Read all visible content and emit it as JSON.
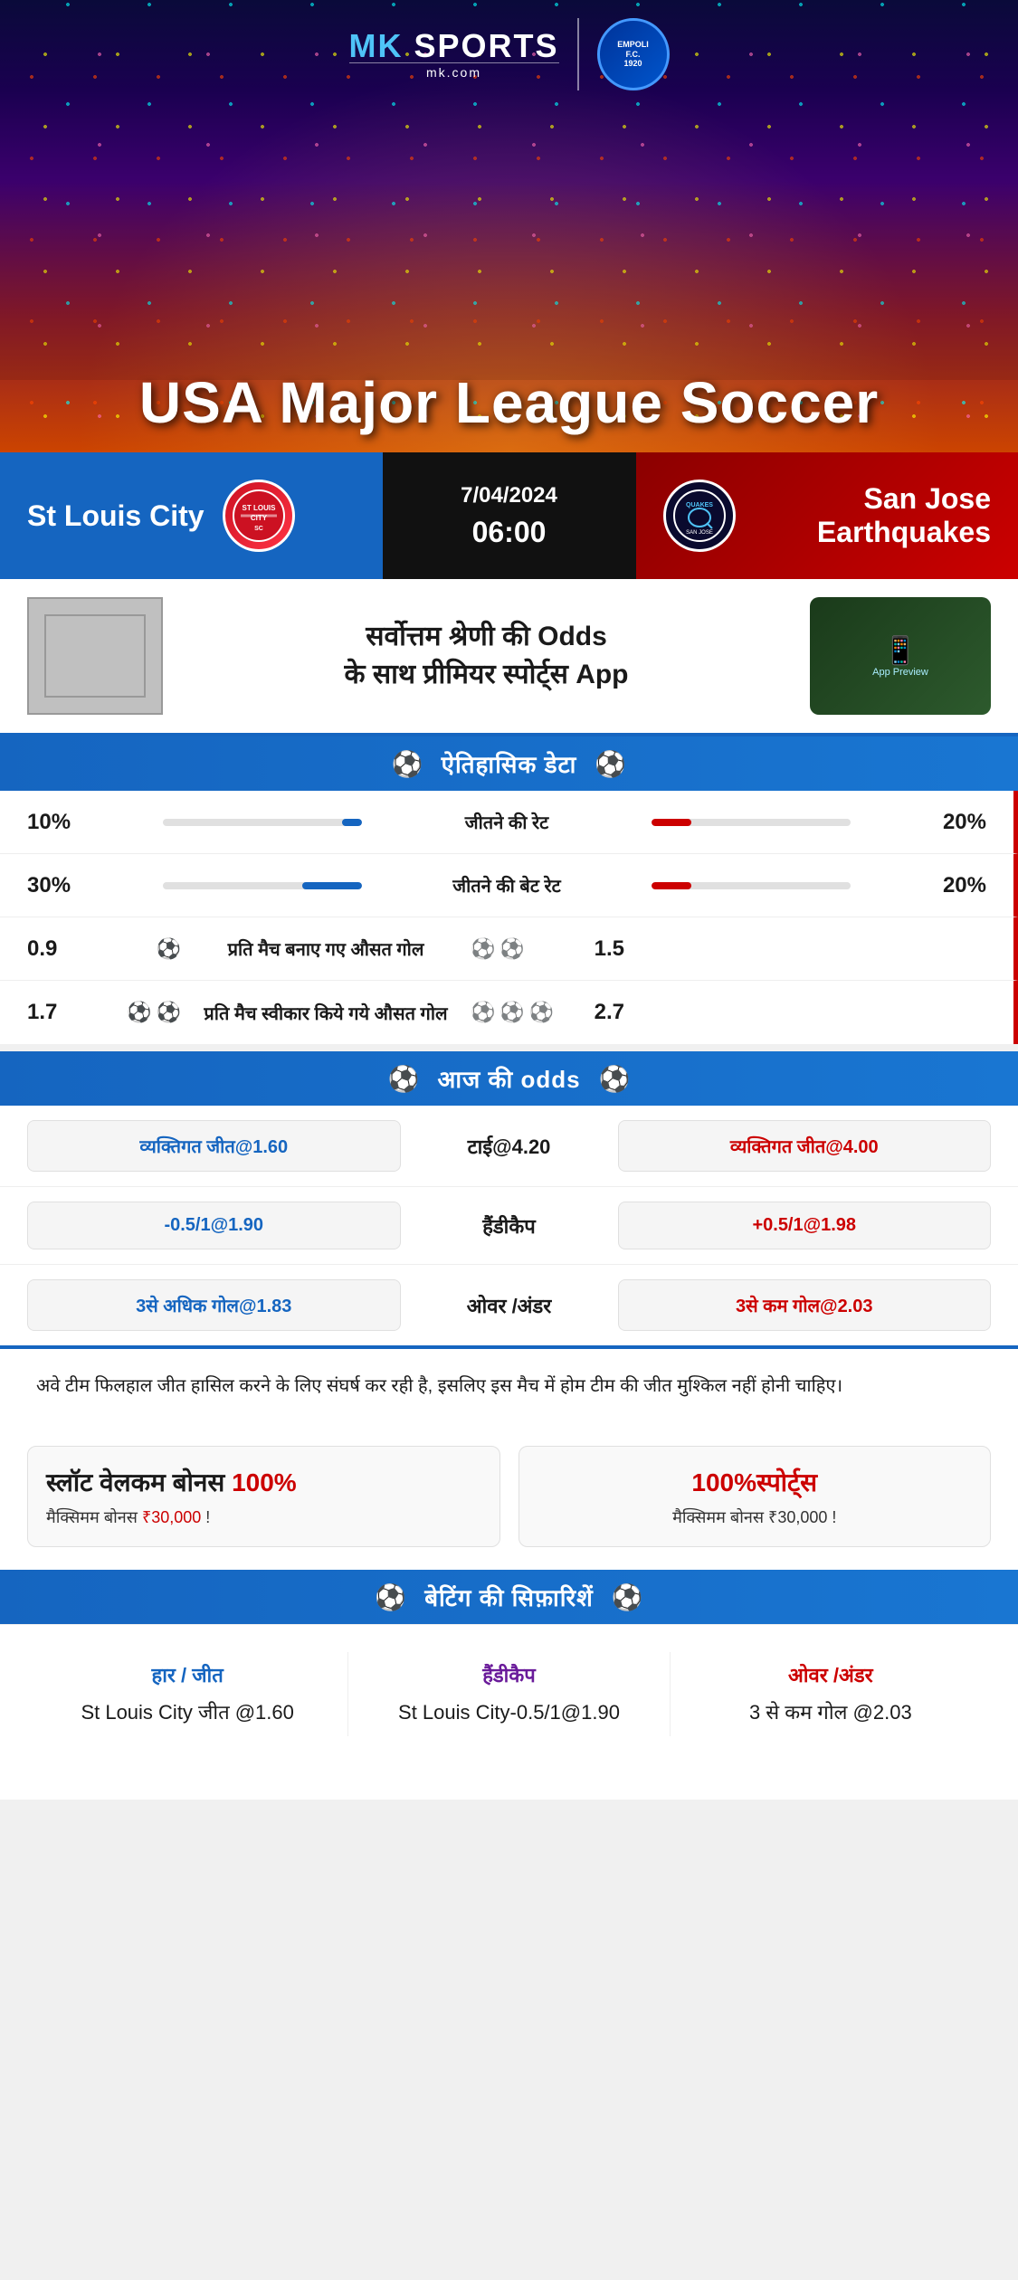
{
  "site": {
    "name": "MK SPORTS",
    "sub": "SPORTS",
    "domain": "mk.com",
    "badge": "EMPOLI F.C.\n1920"
  },
  "hero": {
    "title": "USA Major League Soccer"
  },
  "match": {
    "home_team": "St Louis City",
    "away_team": "San Jose Earthquakes",
    "away_team_short": "QUAKES",
    "date": "7/04/2024",
    "time": "06:00"
  },
  "promo": {
    "main_text": "सर्वोत्तम श्रेणी की Odds\nके साथ प्रीमियर स्पोर्ट्स App"
  },
  "historical": {
    "section_title": "ऐतिहासिक डेटा",
    "stats": [
      {
        "label": "जीतने की रेट",
        "left_val": "10%",
        "right_val": "20%",
        "left_pct": 10,
        "right_pct": 20,
        "type": "bar"
      },
      {
        "label": "जीतने की बेट रेट",
        "left_val": "30%",
        "right_val": "20%",
        "left_pct": 30,
        "right_pct": 20,
        "type": "bar"
      },
      {
        "label": "प्रति मैच बनाए गए औसत गोल",
        "left_val": "0.9",
        "right_val": "1.5",
        "left_balls": 1,
        "right_balls": 2,
        "type": "icon"
      },
      {
        "label": "प्रति मैच स्वीकार किये गये औसत गोल",
        "left_val": "1.7",
        "right_val": "2.7",
        "left_balls": 2,
        "right_balls": 3,
        "type": "icon"
      }
    ]
  },
  "odds": {
    "section_title": "आज की odds",
    "rows": [
      {
        "left_label": "व्यक्तिगत जीत@1.60",
        "center_label": "टाई@4.20",
        "right_label": "व्यक्तिगत जीत@4.00",
        "left_color": "blue",
        "right_color": "red"
      },
      {
        "left_label": "-0.5/1@1.90",
        "center_label": "हैंडीकैप",
        "right_label": "+0.5/1@1.98",
        "left_color": "blue",
        "right_color": "red"
      },
      {
        "left_label": "3से अधिक गोल@1.83",
        "center_label": "ओवर /अंडर",
        "right_label": "3से कम गोल@2.03",
        "left_color": "blue",
        "right_color": "red"
      }
    ]
  },
  "analysis": {
    "text": "अवे टीम फिलहाल जीत हासिल करने के लिए संघर्ष कर रही है, इसलिए इस मैच में होम टीम की जीत मुश्किल नहीं होनी चाहिए।"
  },
  "bonus": {
    "left": {
      "title_prefix": "स्लॉट वेलकम बोनस ",
      "title_highlight": "100%",
      "sub": "मैक्सिमम बोनस ₹30,000  !"
    },
    "right": {
      "title": "100%स्पोर्ट्स",
      "sub": "मैक्सिमम बोनस  ₹30,000 !"
    }
  },
  "recommendations": {
    "section_title": "बेटिंग की सिफ़ारिशें",
    "cols": [
      {
        "title": "हार / जीत",
        "title_color": "blue",
        "value": "St Louis City जीत @1.60"
      },
      {
        "title": "हैंडीकैप",
        "title_color": "purple",
        "value": "St Louis City-0.5/1@1.90"
      },
      {
        "title": "ओवर /अंडर",
        "title_color": "red",
        "value": "3 से कम गोल @2.03"
      }
    ]
  }
}
